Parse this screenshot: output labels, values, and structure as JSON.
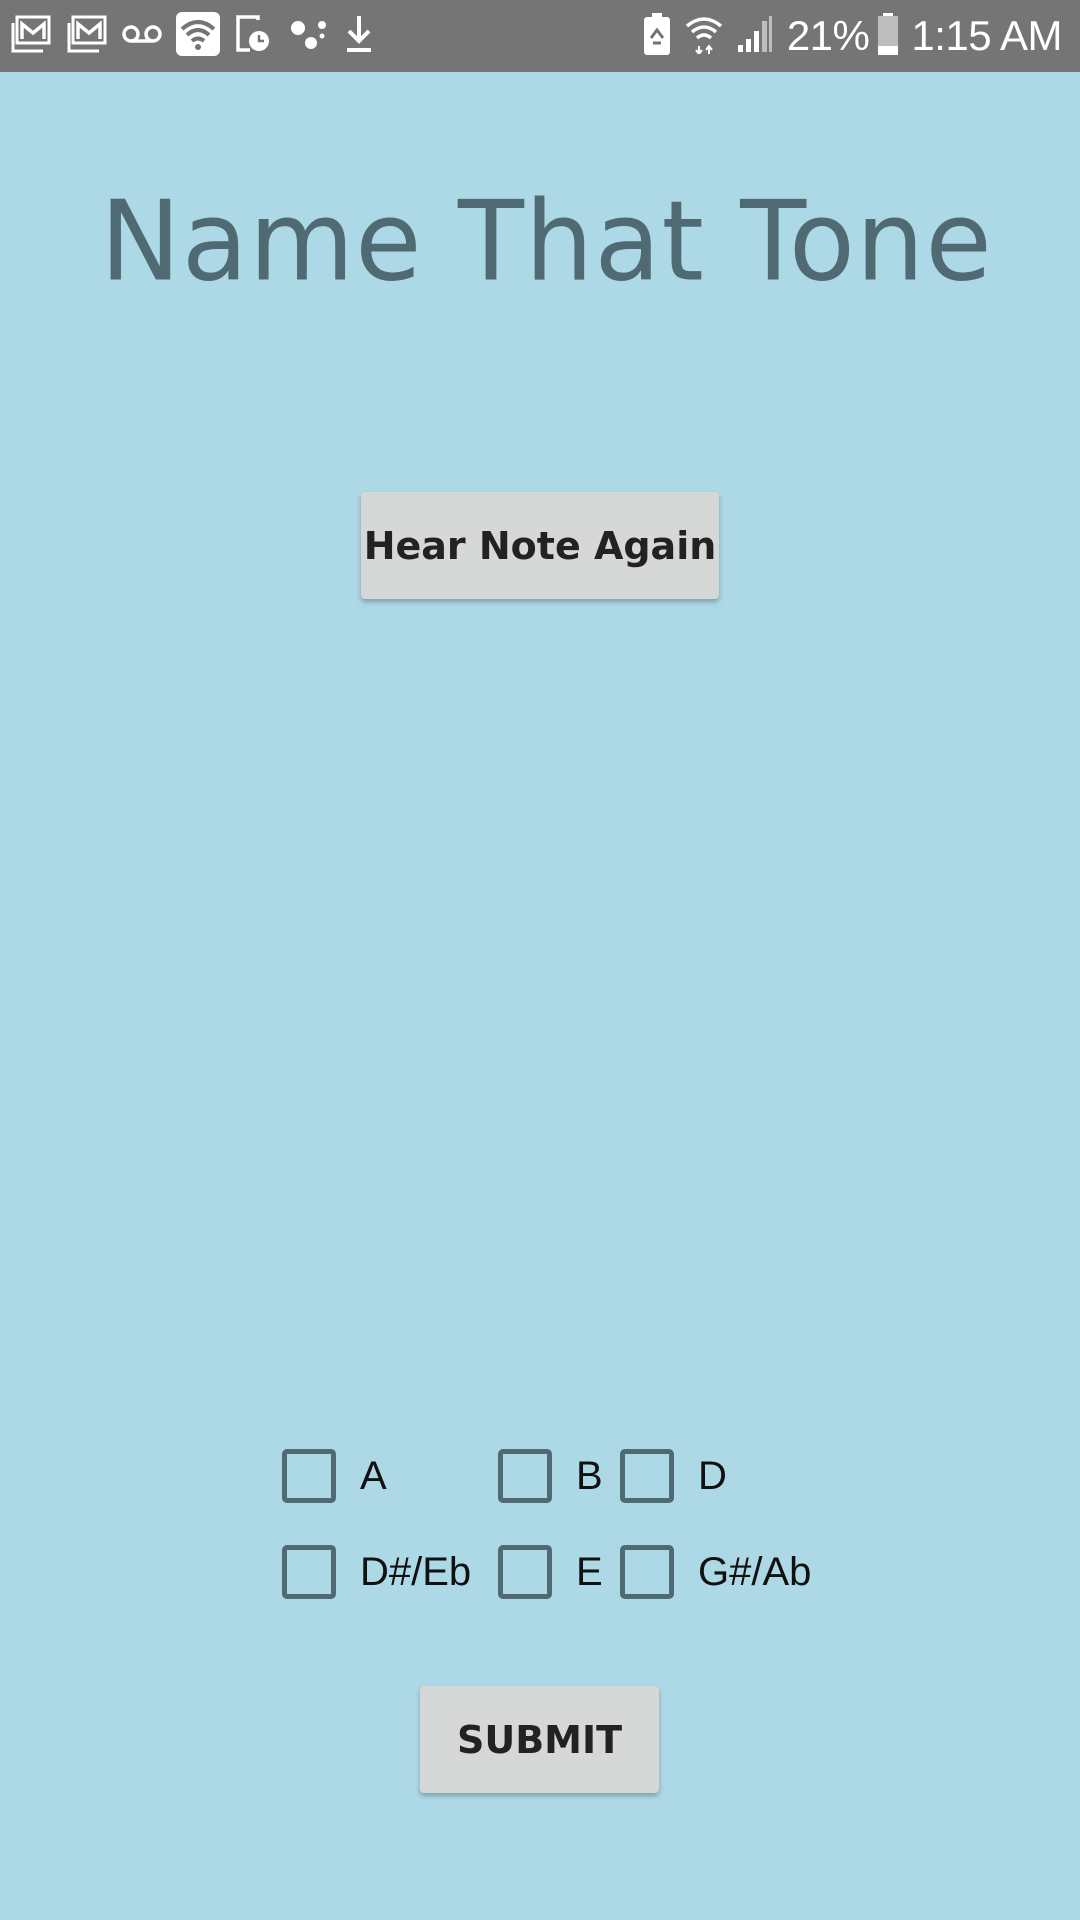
{
  "status_bar": {
    "icons": [
      "gmail-icon",
      "gmail-icon",
      "voicemail-icon",
      "wifi-calling-icon",
      "screen-timer-icon",
      "assistant-icon",
      "download-icon"
    ],
    "right_icons": [
      "battery-saver-icon",
      "wifi-icon",
      "signal-icon"
    ],
    "battery_percent": "21%",
    "time": "1:15 AM",
    "background_color": "#757575"
  },
  "app": {
    "title": "Name That Tone",
    "title_color": "#4f6a72",
    "background_color": "#add8e6"
  },
  "hear_button": {
    "label": "Hear Note Again"
  },
  "choices": [
    {
      "label": "A",
      "checked": false
    },
    {
      "label": "B",
      "checked": false
    },
    {
      "label": "D",
      "checked": false
    },
    {
      "label": "D#/Eb",
      "checked": false
    },
    {
      "label": "E",
      "checked": false
    },
    {
      "label": "G#/Ab",
      "checked": false
    }
  ],
  "submit_button": {
    "label": "SUBMIT"
  }
}
